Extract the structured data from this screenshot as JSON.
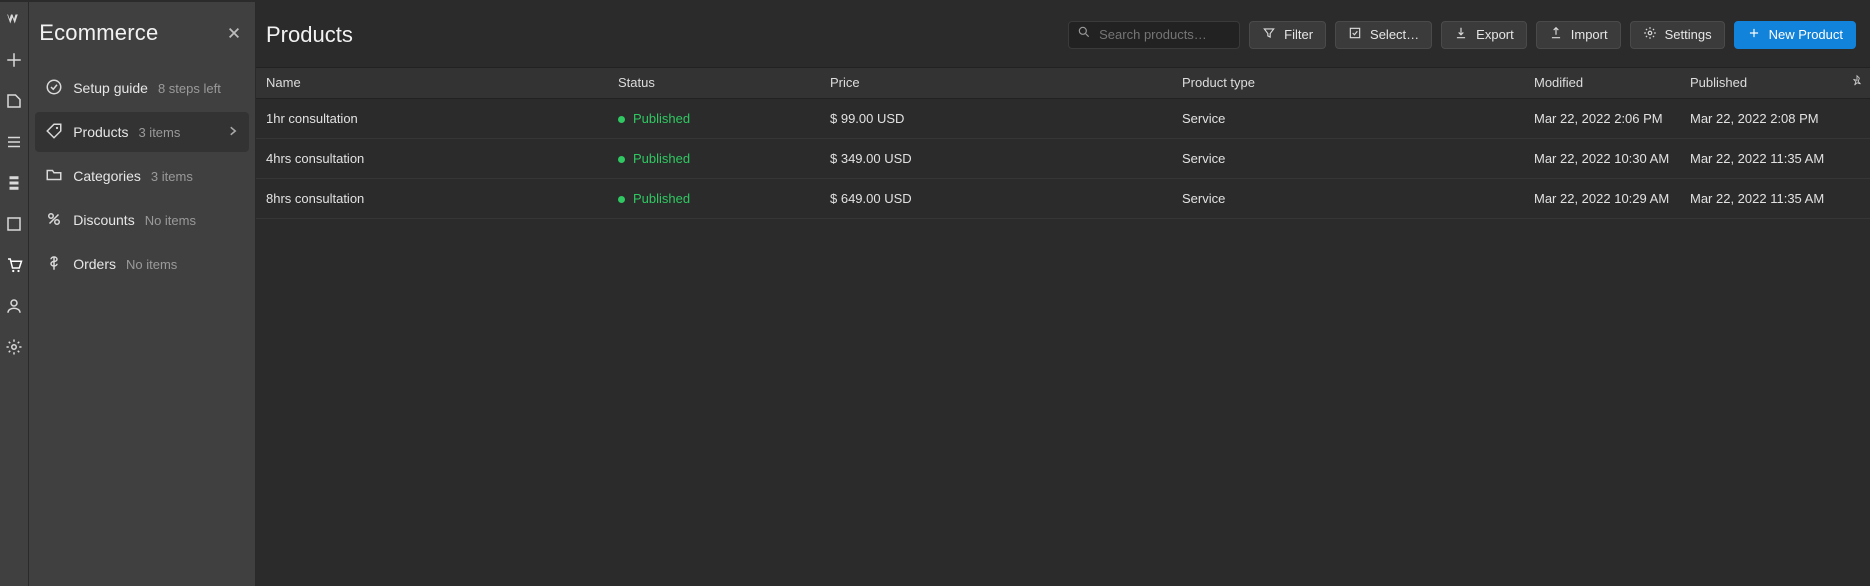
{
  "close_icon": "×",
  "sidebar": {
    "title": "Ecommerce",
    "items": [
      {
        "label": "Setup guide",
        "sub": "8 steps left"
      },
      {
        "label": "Products",
        "sub": "3 items"
      },
      {
        "label": "Categories",
        "sub": "3 items"
      },
      {
        "label": "Discounts",
        "sub": "No items"
      },
      {
        "label": "Orders",
        "sub": "No items"
      }
    ]
  },
  "header": {
    "title": "Products",
    "search_placeholder": "Search products…",
    "filter": "Filter",
    "select": "Select…",
    "export": "Export",
    "import": "Import",
    "settings": "Settings",
    "new": "New Product"
  },
  "columns": {
    "name": "Name",
    "status": "Status",
    "price": "Price",
    "type": "Product type",
    "modified": "Modified",
    "published": "Published"
  },
  "rows": [
    {
      "name": "1hr consultation",
      "status": "Published",
      "price": "$ 99.00 USD",
      "type": "Service",
      "modified": "Mar 22, 2022 2:06 PM",
      "published": "Mar 22, 2022 2:08 PM"
    },
    {
      "name": "4hrs consultation",
      "status": "Published",
      "price": "$ 349.00 USD",
      "type": "Service",
      "modified": "Mar 22, 2022 10:30 AM",
      "published": "Mar 22, 2022 11:35 AM"
    },
    {
      "name": "8hrs consultation",
      "status": "Published",
      "price": "$ 649.00 USD",
      "type": "Service",
      "modified": "Mar 22, 2022 10:29 AM",
      "published": "Mar 22, 2022 11:35 AM"
    }
  ]
}
